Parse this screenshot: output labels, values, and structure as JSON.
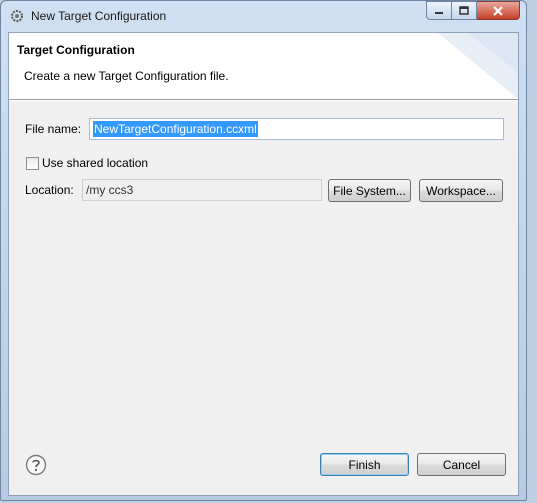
{
  "window": {
    "title": "New Target Configuration",
    "icon": "eclipse-gear-icon"
  },
  "banner": {
    "title": "Target Configuration",
    "message": "Create a new Target Configuration file."
  },
  "form": {
    "file_name_label": "File name:",
    "file_name_value": "NewTargetConfiguration.ccxml",
    "use_shared_location_label": "Use shared location",
    "use_shared_location_checked": false,
    "location_label": "Location:",
    "location_value": "/my ccs3",
    "file_system_button": "File System...",
    "workspace_button": "Workspace..."
  },
  "footer": {
    "finish_button": "Finish",
    "cancel_button": "Cancel",
    "help_icon": "help-icon"
  }
}
